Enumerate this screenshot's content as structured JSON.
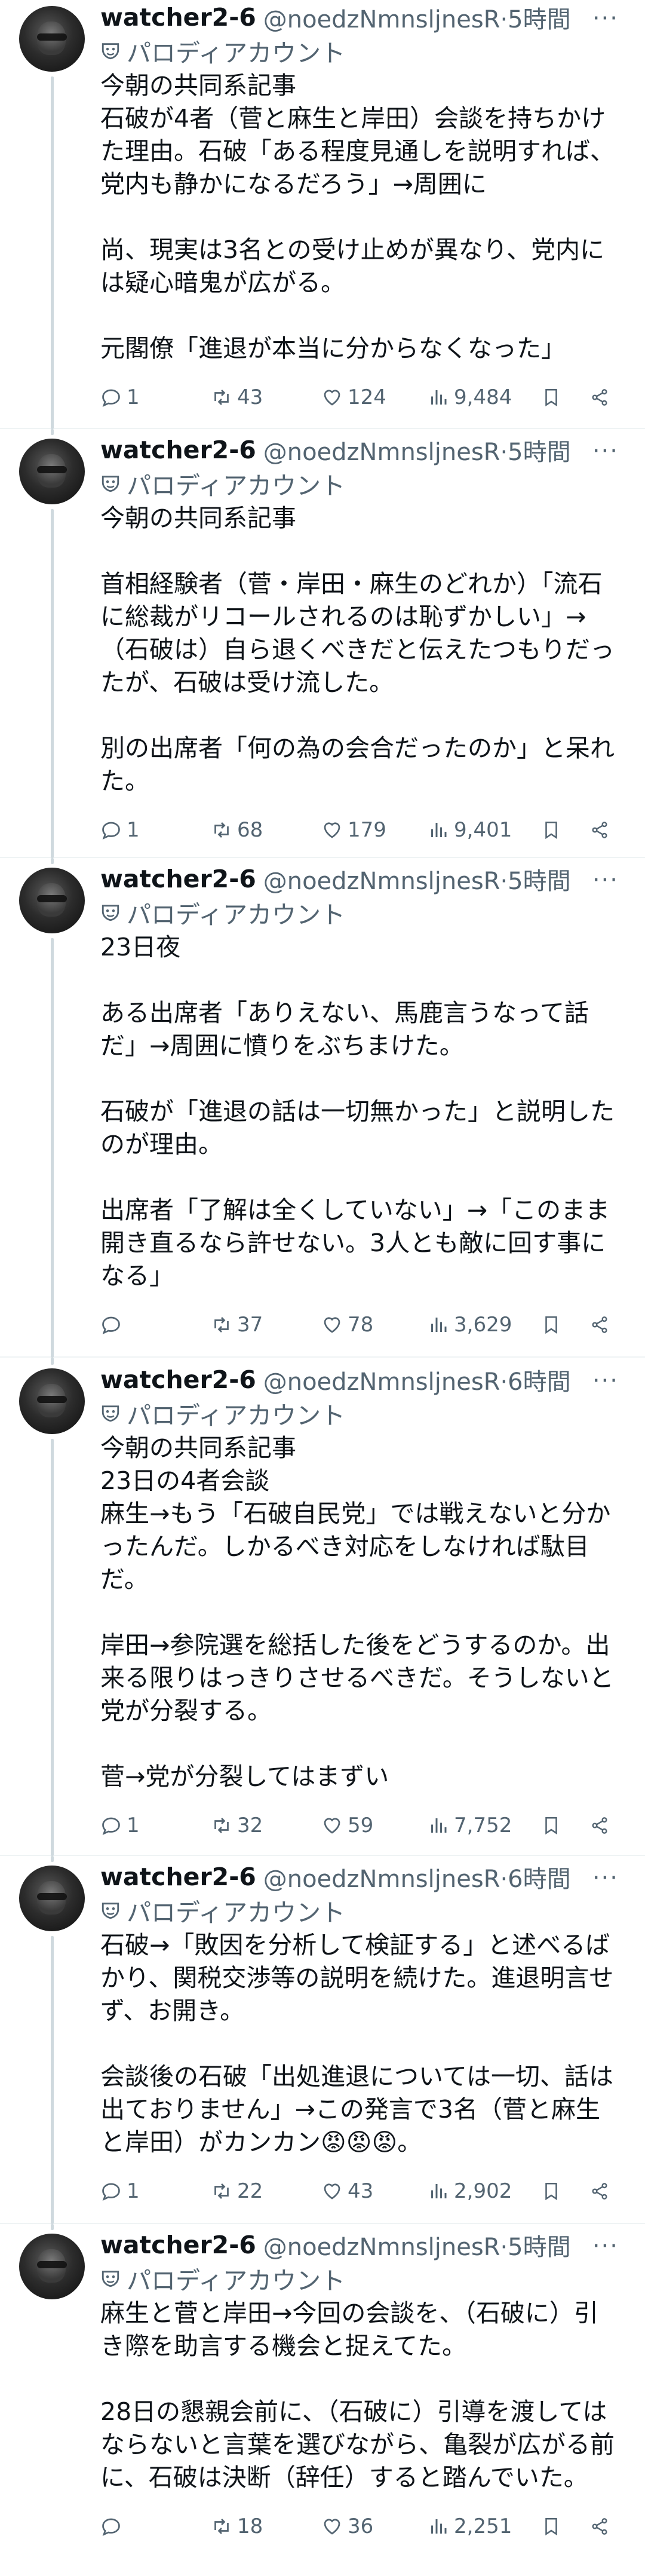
{
  "tweets": [
    {
      "name": "watcher2-6",
      "handle": "@noedzNmnsljnesR",
      "time": "5時間",
      "badge": "パロディアカウント",
      "text": "今朝の共同系記事\n石破が4者（菅と麻生と岸田）会談を持ちかけた理由。石破「ある程度見通しを説明すれば、党内も静かになるだろう」→周囲に\n\n尚、現実は3名との受け止めが異なり、党内には疑心暗鬼が広がる。\n\n元閣僚「進退が本当に分からなくなった」",
      "replies": "1",
      "retweets": "43",
      "likes": "124",
      "views": "9,484"
    },
    {
      "name": "watcher2-6",
      "handle": "@noedzNmnsljnesR",
      "time": "5時間",
      "badge": "パロディアカウント",
      "text": "今朝の共同系記事\n\n首相経験者（菅・岸田・麻生のどれか）「流石に総裁がリコールされるのは恥ずかしい」→（石破は）自ら退くべきだと伝えたつもりだったが、石破は受け流した。\n\n別の出席者「何の為の会合だったのか」と呆れた。",
      "replies": "1",
      "retweets": "68",
      "likes": "179",
      "views": "9,401"
    },
    {
      "name": "watcher2-6",
      "handle": "@noedzNmnsljnesR",
      "time": "5時間",
      "badge": "パロディアカウント",
      "text": "23日夜\n\nある出席者「ありえない、馬鹿言うなって話だ」→周囲に憤りをぶちまけた。\n\n石破が「進退の話は一切無かった」と説明したのが理由。\n\n出席者「了解は全くしていない」→「このまま開き直るなら許せない。3人とも敵に回す事になる」",
      "replies": "",
      "retweets": "37",
      "likes": "78",
      "views": "3,629"
    },
    {
      "name": "watcher2-6",
      "handle": "@noedzNmnsljnesR",
      "time": "6時間",
      "badge": "パロディアカウント",
      "text": "今朝の共同系記事\n23日の4者会談\n麻生→もう「石破自民党」では戦えないと分かったんだ。しかるべき対応をしなければ駄目だ。\n\n岸田→参院選を総括した後をどうするのか。出来る限りはっきりさせるべきだ。そうしないと党が分裂する。\n\n菅→党が分裂してはまずい",
      "replies": "1",
      "retweets": "32",
      "likes": "59",
      "views": "7,752"
    },
    {
      "name": "watcher2-6",
      "handle": "@noedzNmnsljnesR",
      "time": "6時間",
      "badge": "パロディアカウント",
      "text": "石破→「敗因を分析して検証する」と述べるばかり、関税交渉等の説明を続けた。進退明言せず、お開き。\n\n会談後の石破「出処進退については一切、話は出ておりません」→この発言で3名（菅と麻生と岸田）がカンカン😡😡😡。",
      "replies": "1",
      "retweets": "22",
      "likes": "43",
      "views": "2,902"
    },
    {
      "name": "watcher2-6",
      "handle": "@noedzNmnsljnesR",
      "time": "5時間",
      "badge": "パロディアカウント",
      "text": "麻生と菅と岸田→今回の会談を、（石破に）引き際を助言する機会と捉えてた。\n\n28日の懇親会前に、（石破に）引導を渡してはならないと言葉を選びながら、亀裂が広がる前に、石破は決断（辞任）すると踏んでいた。",
      "replies": "",
      "retweets": "18",
      "likes": "36",
      "views": "2,251"
    }
  ]
}
